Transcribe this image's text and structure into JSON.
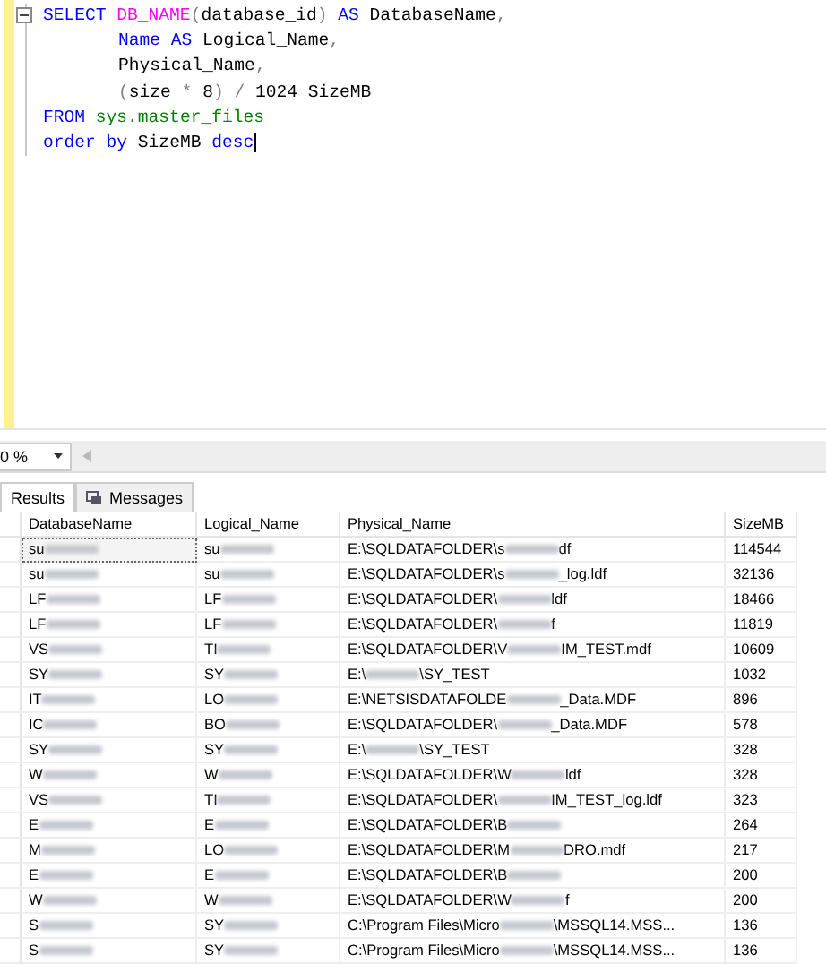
{
  "editor": {
    "lines": [
      {
        "indented": false,
        "tokens": [
          {
            "kind": "keyword",
            "text": "SELECT "
          },
          {
            "kind": "function",
            "text": "DB_NAME"
          },
          {
            "kind": "operator",
            "text": "("
          },
          {
            "kind": "plain",
            "text": "database_id"
          },
          {
            "kind": "operator",
            "text": ") "
          },
          {
            "kind": "keyword",
            "text": "AS"
          },
          {
            "kind": "plain",
            "text": " DatabaseName"
          },
          {
            "kind": "operator",
            "text": ","
          }
        ]
      },
      {
        "indented": true,
        "tokens": [
          {
            "kind": "keyword",
            "text": "Name AS"
          },
          {
            "kind": "plain",
            "text": " Logical_Name"
          },
          {
            "kind": "operator",
            "text": ","
          }
        ]
      },
      {
        "indented": true,
        "tokens": [
          {
            "kind": "plain",
            "text": "Physical_Name"
          },
          {
            "kind": "operator",
            "text": ","
          }
        ]
      },
      {
        "indented": true,
        "tokens": [
          {
            "kind": "operator",
            "text": "("
          },
          {
            "kind": "plain",
            "text": "size "
          },
          {
            "kind": "operator",
            "text": "*"
          },
          {
            "kind": "plain",
            "text": " 8"
          },
          {
            "kind": "operator",
            "text": ") / "
          },
          {
            "kind": "plain",
            "text": "1024 SizeMB"
          }
        ]
      },
      {
        "indented": false,
        "tokens": [
          {
            "kind": "keyword",
            "text": "FROM "
          },
          {
            "kind": "system",
            "text": "sys.master_files"
          }
        ]
      },
      {
        "indented": false,
        "tokens": [
          {
            "kind": "keyword",
            "text": "order by"
          },
          {
            "kind": "plain",
            "text": " SizeMB "
          },
          {
            "kind": "keyword",
            "text": "desc"
          }
        ]
      }
    ]
  },
  "zoom": {
    "value": "0 %"
  },
  "tabs": [
    {
      "label": "Results",
      "selected": true
    },
    {
      "label": "Messages",
      "selected": false
    }
  ],
  "grid": {
    "columns": [
      "DatabaseName",
      "Logical_Name",
      "Physical_Name",
      "SizeMB"
    ],
    "rows": [
      [
        {
          "pre": "su",
          "redacted": true
        },
        {
          "pre": "su",
          "redacted": true
        },
        {
          "pre": "E:\\SQLDATAFOLDER\\s",
          "redacted": true,
          "post": "df"
        },
        {
          "pre": "114544"
        }
      ],
      [
        {
          "pre": "su",
          "redacted": true
        },
        {
          "pre": "su",
          "redacted": true
        },
        {
          "pre": "E:\\SQLDATAFOLDER\\s",
          "redacted": true,
          "post": "_log.ldf"
        },
        {
          "pre": "32136"
        }
      ],
      [
        {
          "pre": "LF",
          "redacted": true
        },
        {
          "pre": "LF",
          "redacted": true
        },
        {
          "pre": "E:\\SQLDATAFOLDER\\",
          "redacted": true,
          "post": "ldf"
        },
        {
          "pre": "18466"
        }
      ],
      [
        {
          "pre": "LF",
          "redacted": true
        },
        {
          "pre": "LF",
          "redacted": true
        },
        {
          "pre": "E:\\SQLDATAFOLDER\\",
          "redacted": true,
          "post": "f"
        },
        {
          "pre": "11819"
        }
      ],
      [
        {
          "pre": "VS",
          "redacted": true
        },
        {
          "pre": "TI",
          "redacted": true
        },
        {
          "pre": "E:\\SQLDATAFOLDER\\V",
          "redacted": true,
          "post": "IM_TEST.mdf"
        },
        {
          "pre": "10609"
        }
      ],
      [
        {
          "pre": "SY",
          "redacted": true
        },
        {
          "pre": "SY",
          "redacted": true
        },
        {
          "pre": "E:\\",
          "redacted": true,
          "post": "\\SY_TEST"
        },
        {
          "pre": "1032"
        }
      ],
      [
        {
          "pre": "IT",
          "redacted": true
        },
        {
          "pre": "LO",
          "redacted": true
        },
        {
          "pre": "E:\\NETSISDATAFOLDE",
          "redacted": true,
          "post": "_Data.MDF"
        },
        {
          "pre": "896"
        }
      ],
      [
        {
          "pre": "IC",
          "redacted": true
        },
        {
          "pre": "BO",
          "redacted": true
        },
        {
          "pre": "E:\\SQLDATAFOLDER\\",
          "redacted": true,
          "post": "_Data.MDF"
        },
        {
          "pre": "578"
        }
      ],
      [
        {
          "pre": "SY",
          "redacted": true
        },
        {
          "pre": "SY",
          "redacted": true
        },
        {
          "pre": "E:\\",
          "redacted": true,
          "post": "\\SY_TEST"
        },
        {
          "pre": "328"
        }
      ],
      [
        {
          "pre": "W",
          "redacted": true
        },
        {
          "pre": "W",
          "redacted": true
        },
        {
          "pre": "E:\\SQLDATAFOLDER\\W",
          "redacted": true,
          "post": "ldf"
        },
        {
          "pre": "328"
        }
      ],
      [
        {
          "pre": "VS",
          "redacted": true
        },
        {
          "pre": "TI",
          "redacted": true
        },
        {
          "pre": "E:\\SQLDATAFOLDER\\",
          "redacted": true,
          "post": "IM_TEST_log.ldf"
        },
        {
          "pre": "323"
        }
      ],
      [
        {
          "pre": "E",
          "redacted": true
        },
        {
          "pre": "E",
          "redacted": true
        },
        {
          "pre": "E:\\SQLDATAFOLDER\\B",
          "redacted": true
        },
        {
          "pre": "264"
        }
      ],
      [
        {
          "pre": "M",
          "redacted": true
        },
        {
          "pre": "LO",
          "redacted": true
        },
        {
          "pre": "E:\\SQLDATAFOLDER\\M",
          "redacted": true,
          "post": "DRO.mdf"
        },
        {
          "pre": "217"
        }
      ],
      [
        {
          "pre": "E",
          "redacted": true
        },
        {
          "pre": "E",
          "redacted": true
        },
        {
          "pre": "E:\\SQLDATAFOLDER\\B",
          "redacted": true
        },
        {
          "pre": "200"
        }
      ],
      [
        {
          "pre": "W",
          "redacted": true
        },
        {
          "pre": "W",
          "redacted": true
        },
        {
          "pre": "E:\\SQLDATAFOLDER\\W",
          "redacted": true,
          "post": "f"
        },
        {
          "pre": "200"
        }
      ],
      [
        {
          "pre": "S",
          "redacted": true
        },
        {
          "pre": "SY",
          "redacted": true
        },
        {
          "pre": "C:\\Program Files\\Micro",
          "redacted": true,
          "post": "\\MSSQL14.MSS..."
        },
        {
          "pre": "136"
        }
      ],
      [
        {
          "pre": "S",
          "redacted": true
        },
        {
          "pre": "SY",
          "redacted": true
        },
        {
          "pre": "C:\\Program Files\\Micro",
          "redacted": true,
          "post": "\\MSSQL14.MSS..."
        },
        {
          "pre": "136"
        }
      ]
    ]
  }
}
